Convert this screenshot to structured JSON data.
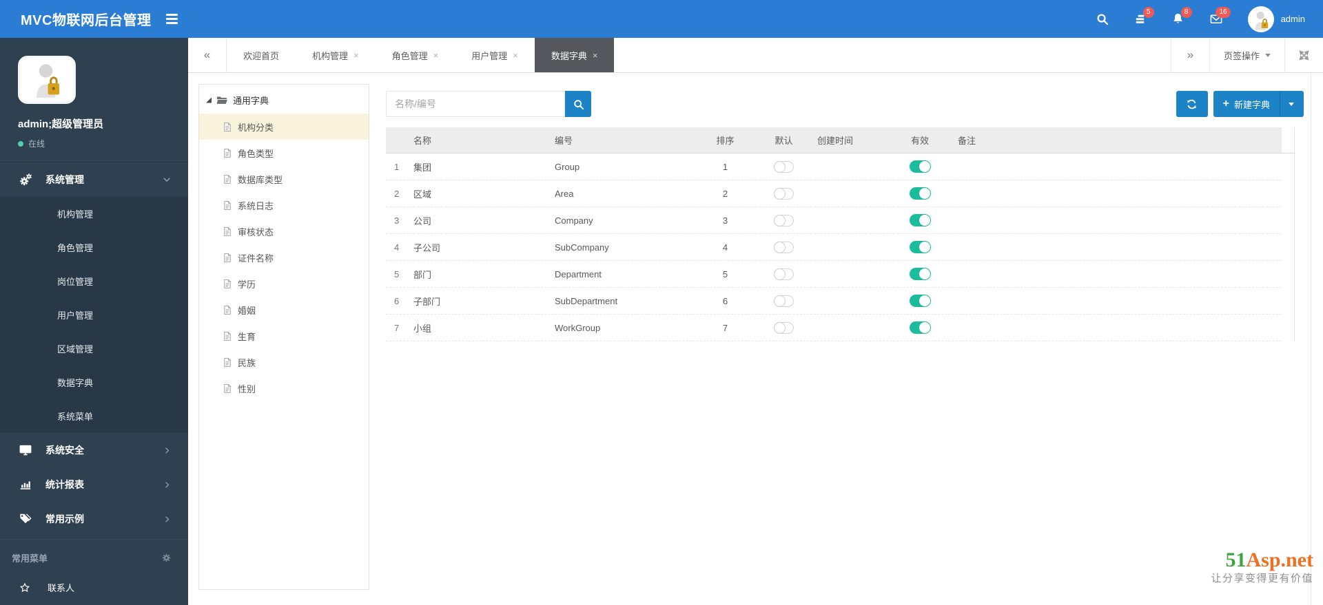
{
  "navbar": {
    "title": "MVC物联网后台管理",
    "username": "admin",
    "badges": {
      "tasks": "5",
      "notifications": "8",
      "messages": "16"
    }
  },
  "icons": {
    "plus": "+",
    "close": "×",
    "scroll_left": "«",
    "scroll_right": "»"
  },
  "sidebar": {
    "profile": {
      "name": "admin;超级管理员",
      "status": "在线"
    },
    "menu": [
      {
        "label": "系统管理"
      },
      {
        "label": "系统安全"
      },
      {
        "label": "统计报表"
      },
      {
        "label": "常用示例"
      }
    ],
    "submenu": [
      "机构管理",
      "角色管理",
      "岗位管理",
      "用户管理",
      "区域管理",
      "数据字典",
      "系统菜单"
    ],
    "section_title": "常用菜单",
    "quick": [
      {
        "label": "联系人"
      }
    ]
  },
  "tabs": {
    "items": [
      {
        "label": "欢迎首页"
      },
      {
        "label": "机构管理"
      },
      {
        "label": "角色管理"
      },
      {
        "label": "用户管理"
      },
      {
        "label": "数据字典"
      }
    ],
    "operations_label": "页签操作"
  },
  "tree": {
    "root": "通用字典",
    "selected": "机构分类",
    "items": [
      "机构分类",
      "角色类型",
      "数据库类型",
      "系统日志",
      "审核状态",
      "证件名称",
      "学历",
      "婚姻",
      "生育",
      "民族",
      "性别"
    ]
  },
  "toolbar": {
    "search_placeholder": "名称/编号",
    "new_button_label": "新建字典"
  },
  "table": {
    "headers": [
      "名称",
      "编号",
      "排序",
      "默认",
      "创建时间",
      "有效",
      "备注"
    ],
    "rows": [
      {
        "index": 1,
        "name": "集团",
        "code": "Group",
        "sort": 1,
        "default": false,
        "created": "",
        "valid": true,
        "remark": ""
      },
      {
        "index": 2,
        "name": "区域",
        "code": "Area",
        "sort": 2,
        "default": false,
        "created": "",
        "valid": true,
        "remark": ""
      },
      {
        "index": 3,
        "name": "公司",
        "code": "Company",
        "sort": 3,
        "default": false,
        "created": "",
        "valid": true,
        "remark": ""
      },
      {
        "index": 4,
        "name": "子公司",
        "code": "SubCompany",
        "sort": 4,
        "default": false,
        "created": "",
        "valid": true,
        "remark": ""
      },
      {
        "index": 5,
        "name": "部门",
        "code": "Department",
        "sort": 5,
        "default": false,
        "created": "",
        "valid": true,
        "remark": ""
      },
      {
        "index": 6,
        "name": "子部门",
        "code": "SubDepartment",
        "sort": 6,
        "default": false,
        "created": "",
        "valid": true,
        "remark": ""
      },
      {
        "index": 7,
        "name": "小组",
        "code": "WorkGroup",
        "sort": 7,
        "default": false,
        "created": "",
        "valid": true,
        "remark": ""
      }
    ]
  },
  "watermark": {
    "brand_green": "51",
    "brand_orange": "Asp.net",
    "slogan": "让分享变得更有价值"
  },
  "colors": {
    "navbar_blue": "#2a7dd2",
    "button_blue": "#1c84c6",
    "toggle_on_green": "#1abc9c",
    "badge_red": "#ed5b56",
    "sidebar_dark": "#2f4050",
    "submenu_dark": "#293846",
    "tab_active": "#54575b",
    "tree_selected_bg": "#fbf4dc"
  }
}
